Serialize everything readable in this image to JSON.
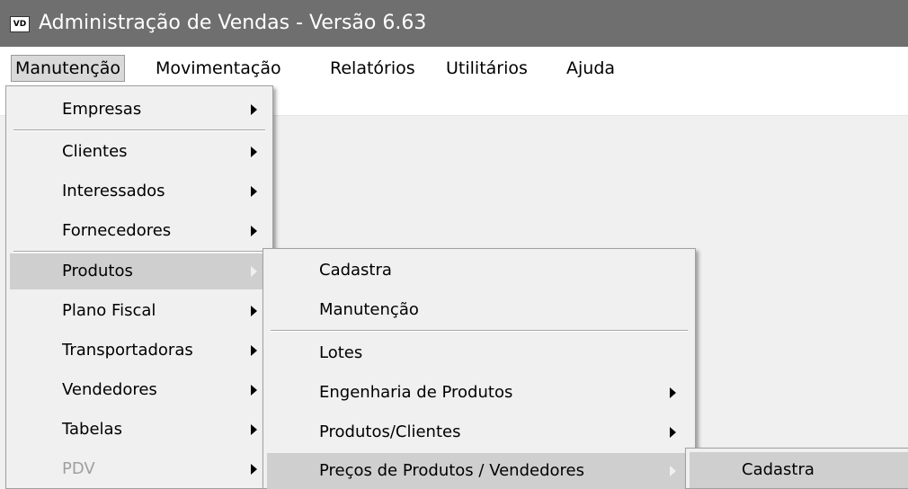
{
  "window": {
    "icon_text": "VD",
    "title": "Administração de Vendas - Versão 6.63"
  },
  "menubar": {
    "items": [
      {
        "label": "Manutenção"
      },
      {
        "label": "Movimentação"
      },
      {
        "label": "Relatórios"
      },
      {
        "label": "Utilitários"
      },
      {
        "label": "Ajuda"
      }
    ]
  },
  "menu_manutencao": {
    "items": [
      {
        "label": "Empresas"
      },
      {
        "label": "Clientes"
      },
      {
        "label": "Interessados"
      },
      {
        "label": "Fornecedores"
      },
      {
        "label": "Produtos"
      },
      {
        "label": "Plano Fiscal"
      },
      {
        "label": "Transportadoras"
      },
      {
        "label": "Vendedores"
      },
      {
        "label": "Tabelas"
      },
      {
        "label": "PDV"
      }
    ]
  },
  "menu_produtos": {
    "items": [
      {
        "label": "Cadastra"
      },
      {
        "label": "Manutenção"
      },
      {
        "label": "Lotes"
      },
      {
        "label": "Engenharia de Produtos"
      },
      {
        "label": "Produtos/Clientes"
      },
      {
        "label": "Preços de Produtos / Vendedores"
      }
    ]
  },
  "menu_precos": {
    "items": [
      {
        "label": "Cadastra"
      }
    ]
  }
}
